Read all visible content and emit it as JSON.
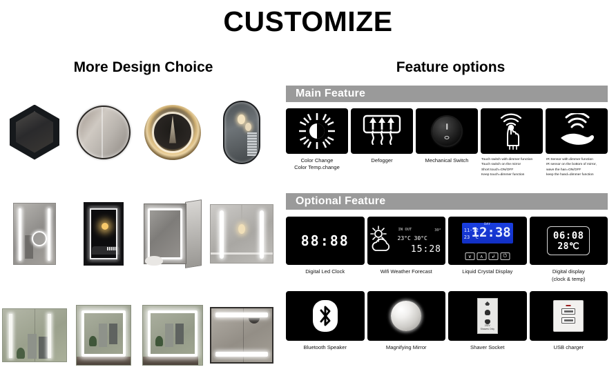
{
  "page": {
    "title": "CUSTOMIZE"
  },
  "columns": {
    "left_heading": "More Design Choice",
    "right_heading": "Feature options"
  },
  "gallery": {
    "rows": [
      [
        {
          "name": "hexagon-led-mirror"
        },
        {
          "name": "round-led-mirror"
        },
        {
          "name": "round-warm-led-ring-mirror"
        },
        {
          "name": "oval-pill-led-mirror"
        }
      ],
      [
        {
          "name": "vertical-rect-led-mirror"
        },
        {
          "name": "dark-frame-led-mirror"
        },
        {
          "name": "led-mirror-cabinet"
        },
        {
          "name": "wide-double-strip-mirror"
        }
      ],
      [
        {
          "name": "wide-cabinet-side-strips"
        },
        {
          "name": "square-full-led-frame-mirror"
        },
        {
          "name": "square-wide-led-frame-mirror"
        },
        {
          "name": "wide-top-bottom-bar-mirror"
        }
      ]
    ]
  },
  "main_feature": {
    "section_label": "Main Feature",
    "tiles": [
      {
        "icon": "sun-contrast-icon",
        "caption_lines": [
          "Color Change",
          "Color Temp.change"
        ],
        "align": "center"
      },
      {
        "icon": "defogger-icon",
        "caption_lines": [
          "Defogger"
        ],
        "align": "center"
      },
      {
        "icon": "rocker-switch-icon",
        "caption_lines": [
          "Mechanical Switch"
        ],
        "align": "center"
      },
      {
        "icon": "touch-hand-icon",
        "caption_lines": [
          "Touch switch with dimmer function",
          "Touch switch on the mirror",
          "Short touch=ON/OFF",
          "Keep touch=dimmer function"
        ],
        "align": "left"
      },
      {
        "icon": "ir-wave-hand-icon",
        "caption_lines": [
          "IR Sensor with dimmer function",
          "IR sensor on the bottom of mirror,",
          "wave the han=ON/OFF",
          "keep the hand=dimmer function"
        ],
        "align": "left"
      }
    ]
  },
  "optional_feature": {
    "section_label": "Optional Feature",
    "row1": [
      {
        "icon": "digital-led-clock-icon",
        "display": "88:88",
        "caption_lines": [
          "Digital Led Clock"
        ]
      },
      {
        "icon": "wifi-weather-forecast-icon",
        "weather": {
          "temp_main": "23°C",
          "temp_sub": "30°C",
          "top_label": "IN  OUT",
          "right_label": "30°",
          "time": "15:28"
        },
        "caption_lines": [
          "Wifi Weather Forecast"
        ]
      },
      {
        "icon": "liquid-crystal-display-icon",
        "lcd": {
          "day": "DAY",
          "date": "11-12",
          "temp": "23 °C",
          "time": "12:38",
          "buttons": [
            "∨",
            "∧",
            "↲",
            "⏻"
          ]
        },
        "caption_lines": [
          "Liquid Crystal Display"
        ]
      },
      {
        "icon": "digital-display-icon",
        "display": {
          "time": "06:08",
          "temp": "28℃"
        },
        "caption_lines": [
          "Digital display",
          "(clock & temp)"
        ]
      }
    ],
    "row2": [
      {
        "icon": "bluetooth-icon",
        "caption_lines": [
          "Bluetooth Speaker"
        ]
      },
      {
        "icon": "magnifying-mirror-icon",
        "caption_lines": [
          "Magnifying Mirror"
        ]
      },
      {
        "icon": "shaver-socket-icon",
        "socket_text": [
          "230V",
          "Shavers Only"
        ],
        "caption_lines": [
          "Shaver Socket"
        ]
      },
      {
        "icon": "usb-charger-icon",
        "caption_lines": [
          "USB charger"
        ]
      }
    ]
  },
  "colors": {
    "section_bar": "#9a9a9a",
    "tile_background": "#000000",
    "lcd_blue": "#1230c4",
    "text": "#000000"
  }
}
